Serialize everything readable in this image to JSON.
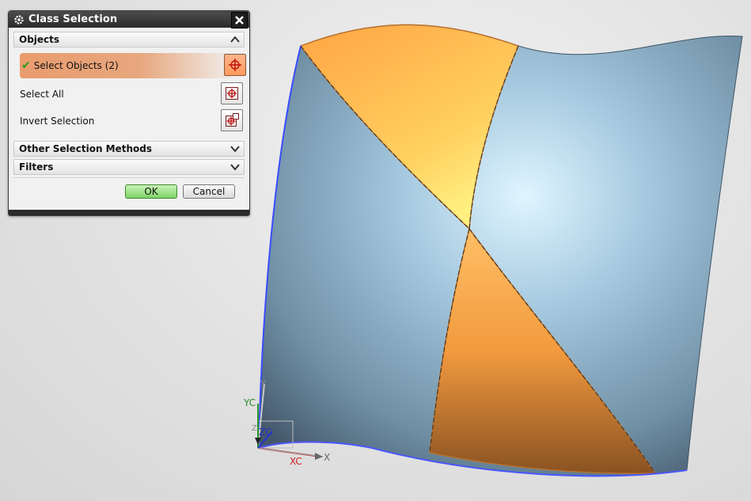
{
  "dialog": {
    "title": "Class Selection",
    "sections": {
      "objects": "Objects",
      "other": "Other Selection Methods",
      "filters": "Filters"
    },
    "rows": {
      "select_objects": "Select Objects (2)",
      "select_all": "Select All",
      "invert": "Invert Selection"
    },
    "buttons": {
      "ok": "OK",
      "cancel": "Cancel"
    }
  },
  "triad": {
    "yc": "YC",
    "y": "Y",
    "zc": "ZC",
    "z": "Z",
    "xc": "XC",
    "x": "X"
  },
  "colors": {
    "selected_face": "#ffa444",
    "surface": "#8fb6d0",
    "accent_green": "#7fd466"
  },
  "icons": [
    "gear-icon",
    "close-icon",
    "chevron-up-icon",
    "chevron-down-icon",
    "crosshair-icon",
    "check-icon"
  ]
}
